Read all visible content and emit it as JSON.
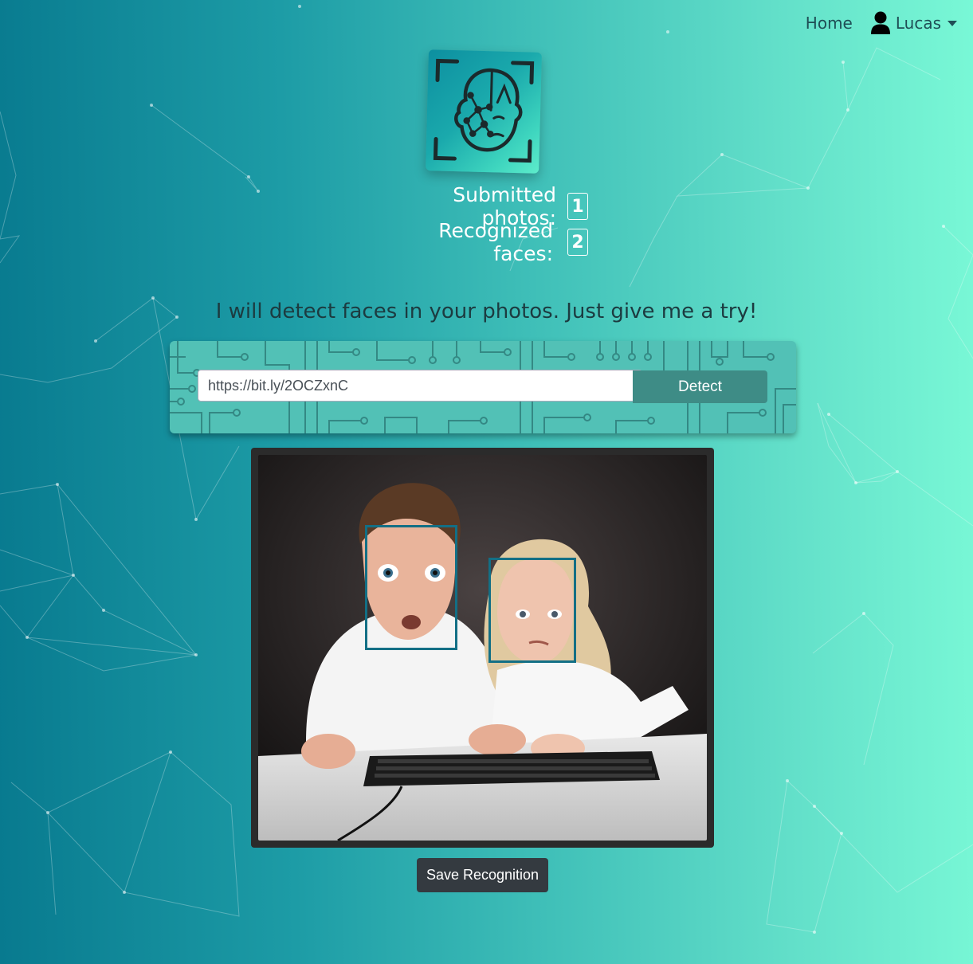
{
  "nav": {
    "home_label": "Home",
    "user_name": "Lucas"
  },
  "stats": {
    "submitted_label": "Submitted photos:",
    "submitted_count": "1",
    "recognized_label": "Recognized faces:",
    "recognized_count": "2"
  },
  "tagline": "I will detect faces in your photos. Just give me a try!",
  "form": {
    "url_value": "https://bit.ly/2OCZxnC",
    "detect_label": "Detect"
  },
  "actions": {
    "save_label": "Save Recognition"
  },
  "colors": {
    "face_box": "#136f85",
    "save_button": "#343a40",
    "gradient_start": "#087a8f",
    "gradient_end": "#79f8d6"
  },
  "icons": {
    "user": "user-icon",
    "logo": "face-scan-logo"
  }
}
